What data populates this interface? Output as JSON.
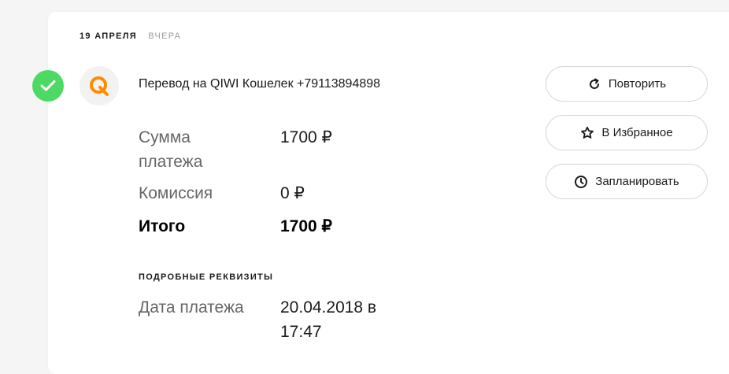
{
  "header": {
    "date": "19 АПРЕЛЯ",
    "relative_date": "ВЧЕРА"
  },
  "payment": {
    "title": "Перевод на QIWI Кошелек +79113894898",
    "status_icon": "check-icon",
    "provider_icon": "qiwi-logo",
    "amount_label_line1": "Сумма",
    "amount_label_line2": "платежа",
    "amount_value": "1700 ₽",
    "commission_label": "Комиссия",
    "commission_value": "0 ₽",
    "total_label": "Итого",
    "total_value": "1700 ₽"
  },
  "details": {
    "section_title": "ПОДРОБНЫЕ РЕКВИЗИТЫ",
    "date_label": "Дата платежа",
    "date_value_line1": "20.04.2018 в",
    "date_value_line2": "17:47"
  },
  "actions": {
    "repeat_label": "Повторить",
    "favorite_label": "В Избранное",
    "schedule_label": "Запланировать"
  },
  "colors": {
    "success": "#4cd964",
    "qiwi_orange": "#ff8c00",
    "background": "#f5f5f5"
  }
}
